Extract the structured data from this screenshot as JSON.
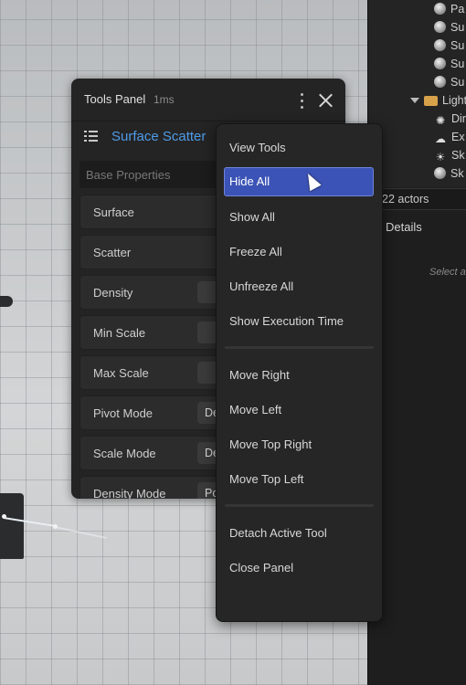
{
  "outliner": {
    "items": [
      {
        "label": "Pa",
        "icon": "sphere-icon"
      },
      {
        "label": "Su",
        "icon": "sphere-icon"
      },
      {
        "label": "Su",
        "icon": "sphere-icon"
      },
      {
        "label": "Su",
        "icon": "sphere-icon"
      },
      {
        "label": "Su",
        "icon": "sphere-icon"
      },
      {
        "label": "Light",
        "icon": "folder-icon"
      },
      {
        "label": "Dir",
        "icon": "directional-light-icon"
      },
      {
        "label": "Ex",
        "icon": "fog-icon"
      },
      {
        "label": "Sk",
        "icon": "sky-light-icon"
      },
      {
        "label": "Sk",
        "icon": "sky-sphere-icon"
      }
    ],
    "actors_count": "22 actors",
    "details_tab": "Details",
    "select_hint": "Select a"
  },
  "panel": {
    "title": "Tools Panel",
    "timing": "1ms",
    "active_tool": "Surface Scatter",
    "section": "Base Properties",
    "properties": [
      {
        "label": "Surface",
        "value": ""
      },
      {
        "label": "Scatter",
        "value": ""
      },
      {
        "label": "Density",
        "value": ""
      },
      {
        "label": "Min Scale",
        "value": ""
      },
      {
        "label": "Max Scale",
        "value": ""
      },
      {
        "label": "Pivot Mode",
        "value": "De"
      },
      {
        "label": "Scale Mode",
        "value": "De"
      },
      {
        "label": "Density Mode",
        "value": "Po"
      }
    ]
  },
  "menu": {
    "items": [
      {
        "label": "View Tools"
      },
      {
        "label": "Hide All",
        "highlighted": true
      },
      {
        "label": "Show All"
      },
      {
        "label": "Freeze All"
      },
      {
        "label": "Unfreeze All"
      },
      {
        "label": "Show Execution Time"
      },
      {
        "label": "Move Right"
      },
      {
        "label": "Move Left"
      },
      {
        "label": "Move Top Right"
      },
      {
        "label": "Move Top Left"
      },
      {
        "label": "Detach Active Tool"
      },
      {
        "label": "Close Panel"
      }
    ]
  },
  "colors": {
    "accent": "#3b53b6",
    "tool_link": "#4e9be8",
    "panel_bg": "#242424"
  }
}
